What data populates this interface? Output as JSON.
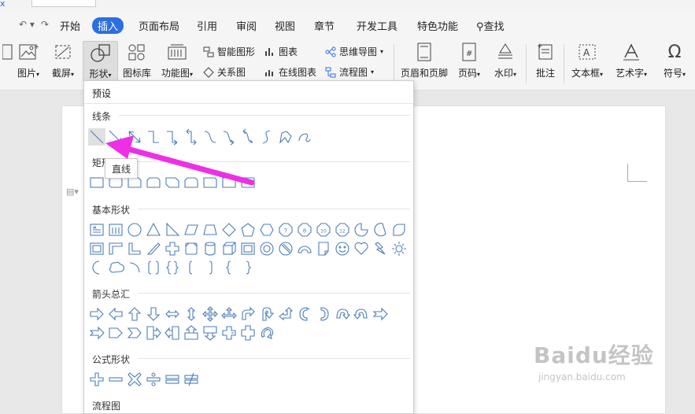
{
  "menu": [
    "开始",
    "插入",
    "页面布局",
    "引用",
    "审阅",
    "视图",
    "章节",
    "开发工具",
    "特色功能"
  ],
  "search_label": "查找",
  "ribbon": {
    "picture": "图片",
    "screenshot": "截屏",
    "shape": "形状",
    "iconlib": "图标库",
    "funcchart": "功能图",
    "smartart": "智能图形",
    "chart": "图表",
    "mindmap": "思维导图",
    "relation": "关系图",
    "onlinechart": "在线图表",
    "flowchart": "流程图",
    "headerfooter": "页眉和页脚",
    "pagenum": "页码",
    "watermark": "水印",
    "comment": "批注",
    "textbox": "文本框",
    "wordart": "艺术字",
    "symbol": "符号"
  },
  "dropdown": {
    "header": "预设",
    "sections": {
      "lines": "线条",
      "rect": "矩形",
      "basic": "基本形状",
      "arrows": "箭头总汇",
      "formula": "公式形状",
      "flow": "流程图"
    },
    "basic_numbers": [
      "7",
      "8",
      "10",
      "12"
    ]
  },
  "tooltip": "直线",
  "watermark": {
    "logo": "Baidu经验",
    "url": "jingyan.baidu.com"
  },
  "colors": {
    "accent": "#2c6fe0",
    "arrow": "#ee2fe6",
    "shape_stroke": "#4d7db8"
  }
}
